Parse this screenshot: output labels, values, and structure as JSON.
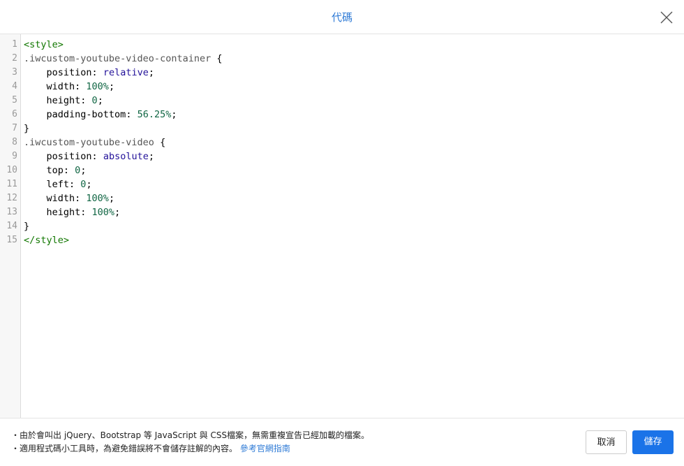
{
  "header": {
    "title": "代碼"
  },
  "editor": {
    "line_numbers": [
      "1",
      "2",
      "3",
      "4",
      "5",
      "6",
      "7",
      "8",
      "9",
      "10",
      "11",
      "12",
      "13",
      "14",
      "15"
    ],
    "lines": [
      [
        {
          "t": "tag",
          "v": "<style>"
        }
      ],
      [
        {
          "t": "sel",
          "v": ".iwcustom-youtube-video-container"
        },
        {
          "t": "plain",
          "v": " {"
        }
      ],
      [
        {
          "t": "prop",
          "v": "    position"
        },
        {
          "t": "plain",
          "v": ": "
        },
        {
          "t": "kw",
          "v": "relative"
        },
        {
          "t": "plain",
          "v": ";"
        }
      ],
      [
        {
          "t": "prop",
          "v": "    width"
        },
        {
          "t": "plain",
          "v": ": "
        },
        {
          "t": "num",
          "v": "100%"
        },
        {
          "t": "plain",
          "v": ";"
        }
      ],
      [
        {
          "t": "prop",
          "v": "    height"
        },
        {
          "t": "plain",
          "v": ": "
        },
        {
          "t": "num",
          "v": "0"
        },
        {
          "t": "plain",
          "v": ";"
        }
      ],
      [
        {
          "t": "prop",
          "v": "    padding-bottom"
        },
        {
          "t": "plain",
          "v": ": "
        },
        {
          "t": "num",
          "v": "56.25%"
        },
        {
          "t": "plain",
          "v": ";"
        }
      ],
      [
        {
          "t": "plain",
          "v": "}"
        }
      ],
      [
        {
          "t": "sel",
          "v": ".iwcustom-youtube-video"
        },
        {
          "t": "plain",
          "v": " {"
        }
      ],
      [
        {
          "t": "prop",
          "v": "    position"
        },
        {
          "t": "plain",
          "v": ": "
        },
        {
          "t": "kw",
          "v": "absolute"
        },
        {
          "t": "plain",
          "v": ";"
        }
      ],
      [
        {
          "t": "prop",
          "v": "    top"
        },
        {
          "t": "plain",
          "v": ": "
        },
        {
          "t": "num",
          "v": "0"
        },
        {
          "t": "plain",
          "v": ";"
        }
      ],
      [
        {
          "t": "prop",
          "v": "    left"
        },
        {
          "t": "plain",
          "v": ": "
        },
        {
          "t": "num",
          "v": "0"
        },
        {
          "t": "plain",
          "v": ";"
        }
      ],
      [
        {
          "t": "prop",
          "v": "    width"
        },
        {
          "t": "plain",
          "v": ": "
        },
        {
          "t": "num",
          "v": "100%"
        },
        {
          "t": "plain",
          "v": ";"
        }
      ],
      [
        {
          "t": "prop",
          "v": "    height"
        },
        {
          "t": "plain",
          "v": ": "
        },
        {
          "t": "num",
          "v": "100%"
        },
        {
          "t": "plain",
          "v": ";"
        }
      ],
      [
        {
          "t": "plain",
          "v": "}"
        }
      ],
      [
        {
          "t": "tag",
          "v": "</style>"
        }
      ]
    ]
  },
  "footer": {
    "note1": "・由於會叫出 jQuery、Bootstrap 等 JavaScript 與 CSS檔案，無需重複宣告已經加載的檔案。",
    "note2": "・適用程式碼小工具時，為避免錯誤將不會儲存註解的內容。",
    "note2_link": "參考官網指南",
    "cancel_label": "取消",
    "save_label": "儲存"
  },
  "icons": {
    "close": "close-icon"
  },
  "colors": {
    "accent": "#1a73e8",
    "title": "#2f7bd6",
    "tag": "#117700",
    "keyword": "#221199",
    "number": "#116644"
  }
}
